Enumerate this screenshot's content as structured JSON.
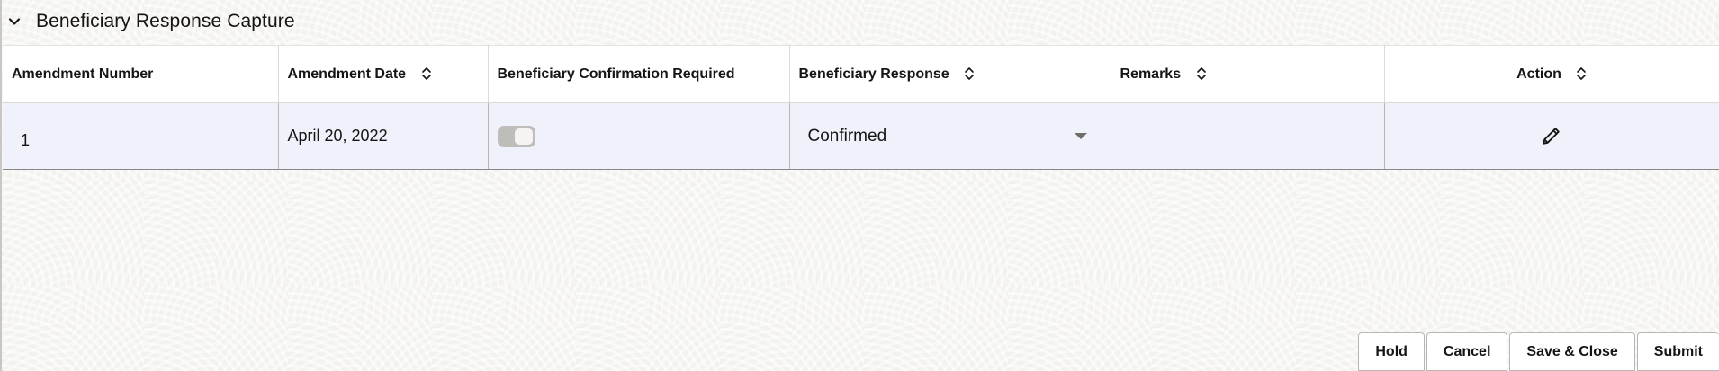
{
  "section": {
    "title": "Beneficiary Response Capture"
  },
  "table": {
    "columns": [
      {
        "label": "Amendment Number",
        "sortable": false
      },
      {
        "label": "Amendment Date",
        "sortable": true
      },
      {
        "label": "Beneficiary Confirmation Required",
        "sortable": false
      },
      {
        "label": "Beneficiary Response",
        "sortable": true
      },
      {
        "label": "Remarks",
        "sortable": true
      },
      {
        "label": "Action",
        "sortable": true
      }
    ],
    "rows": [
      {
        "amendment_number": "1",
        "amendment_date": "April 20, 2022",
        "confirmation_required": false,
        "beneficiary_response": "Confirmed",
        "remarks": "",
        "action_icon": "pencil-icon"
      }
    ]
  },
  "footer": {
    "hold_label": "Hold",
    "cancel_label": "Cancel",
    "save_close_label": "Save & Close",
    "submit_label": "Submit"
  },
  "colors": {
    "row_background": "#eff1fb",
    "header_background": "#ffffff",
    "toggle_off": "#bfbdb9"
  }
}
